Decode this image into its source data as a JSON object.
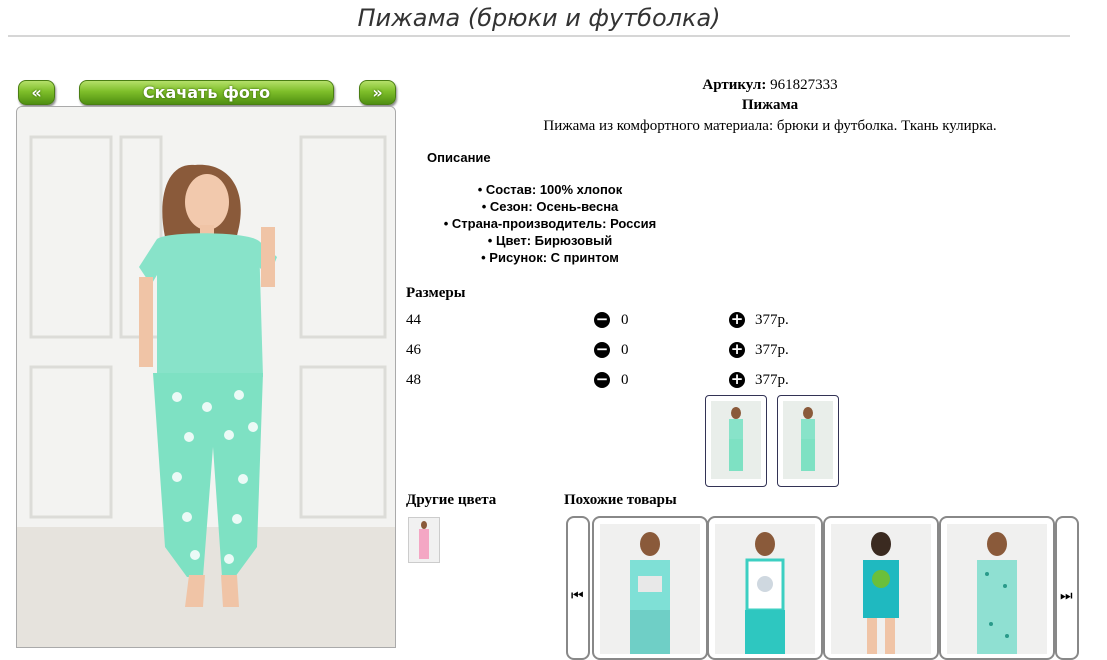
{
  "page": {
    "title": "Пижама (брюки и футболка)"
  },
  "gallery": {
    "prev_label": "«",
    "download_label": "Скачать фото",
    "next_label": "»"
  },
  "product": {
    "article_label": "Артикул:",
    "article_value": "961827333",
    "name": "Пижама",
    "summary": "Пижама из комфортного материала: брюки и футболка. Ткань кулирка.",
    "description_heading": "Описание",
    "description_items": [
      "Состав: 100% хлопок",
      "Сезон: Осень-весна",
      "Страна-производитель: Россия",
      "Цвет: Бирюзовый",
      "Рисунок: С принтом"
    ]
  },
  "sizes": {
    "heading": "Размеры",
    "rows": [
      {
        "size": "44",
        "qty": "0",
        "price": "377р."
      },
      {
        "size": "46",
        "qty": "0",
        "price": "377р."
      },
      {
        "size": "48",
        "qty": "0",
        "price": "377р."
      }
    ]
  },
  "other_colors": {
    "heading": "Другие цвета"
  },
  "similar": {
    "heading": "Похожие товары"
  },
  "colors": {
    "accent_green": "#7fbf2a",
    "mint": "#7fe0c3"
  }
}
